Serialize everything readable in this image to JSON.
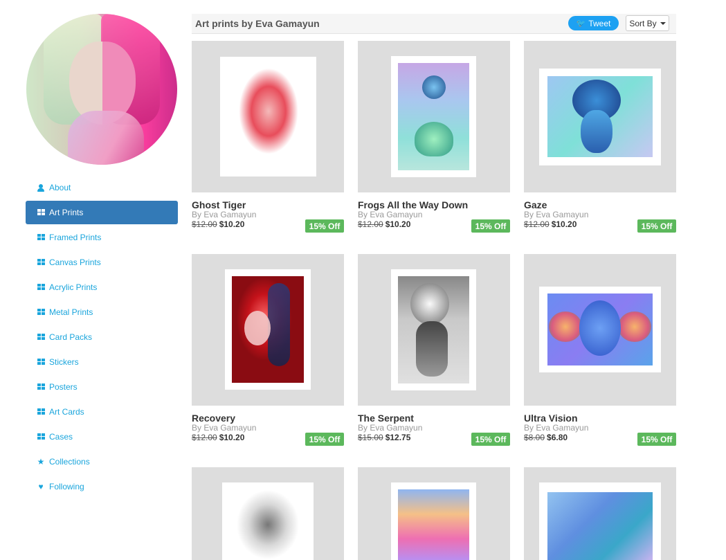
{
  "sidebar": {
    "items": [
      {
        "label": "About",
        "icon": "user-icon",
        "active": false
      },
      {
        "label": "Art Prints",
        "icon": "grid-icon",
        "active": true
      },
      {
        "label": "Framed Prints",
        "icon": "grid-icon",
        "active": false
      },
      {
        "label": "Canvas Prints",
        "icon": "grid-icon",
        "active": false
      },
      {
        "label": "Acrylic Prints",
        "icon": "grid-icon",
        "active": false
      },
      {
        "label": "Metal Prints",
        "icon": "grid-icon",
        "active": false
      },
      {
        "label": "Card Packs",
        "icon": "grid-icon",
        "active": false
      },
      {
        "label": "Stickers",
        "icon": "grid-icon",
        "active": false
      },
      {
        "label": "Posters",
        "icon": "grid-icon",
        "active": false
      },
      {
        "label": "Art Cards",
        "icon": "grid-icon",
        "active": false
      },
      {
        "label": "Cases",
        "icon": "grid-icon",
        "active": false
      },
      {
        "label": "Collections",
        "icon": "star-icon",
        "active": false
      },
      {
        "label": "Following",
        "icon": "heart-icon",
        "active": false
      }
    ]
  },
  "header": {
    "title": "Art prints by Eva Gamayun",
    "tweet_label": "Tweet",
    "sort_label": "Sort By"
  },
  "products": [
    {
      "title": "Ghost Tiger",
      "artist": "By Eva Gamayun",
      "old_price": "$12.00",
      "new_price": "$10.20",
      "badge": "15% Off"
    },
    {
      "title": "Frogs All the Way Down",
      "artist": "By Eva Gamayun",
      "old_price": "$12.00",
      "new_price": "$10.20",
      "badge": "15% Off"
    },
    {
      "title": "Gaze",
      "artist": "By Eva Gamayun",
      "old_price": "$12.00",
      "new_price": "$10.20",
      "badge": "15% Off"
    },
    {
      "title": "Recovery",
      "artist": "By Eva Gamayun",
      "old_price": "$12.00",
      "new_price": "$10.20",
      "badge": "15% Off"
    },
    {
      "title": "The Serpent",
      "artist": "By Eva Gamayun",
      "old_price": "$15.00",
      "new_price": "$12.75",
      "badge": "15% Off"
    },
    {
      "title": "Ultra Vision",
      "artist": "By Eva Gamayun",
      "old_price": "$8.00",
      "new_price": "$6.80",
      "badge": "15% Off"
    }
  ],
  "colors": {
    "accent": "#1aa5dc",
    "active_bg": "#337ab7",
    "badge_bg": "#5cb85c",
    "tweet_bg": "#1da1f2",
    "thumb_bg": "#dddddd"
  }
}
